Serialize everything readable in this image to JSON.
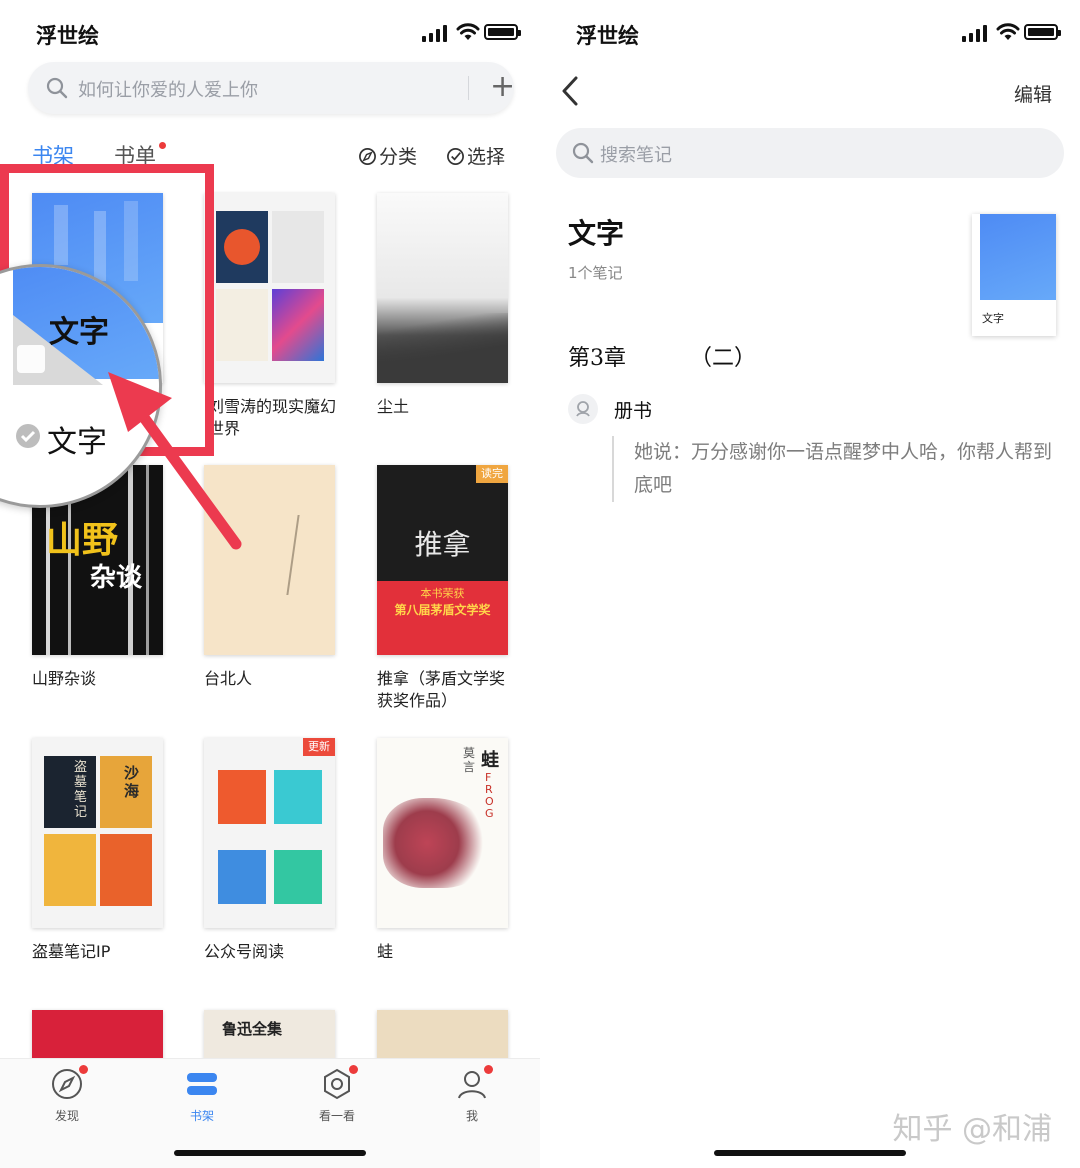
{
  "left": {
    "status": {
      "carrier": "浮世绘"
    },
    "search": {
      "placeholder": "如何让你爱的人爱上你",
      "add_label": "+"
    },
    "tabs": [
      {
        "label": "书架",
        "active": true
      },
      {
        "label": "书单",
        "active": false,
        "dot": true
      }
    ],
    "tools": {
      "classify": "分类",
      "select": "选择"
    },
    "books": [
      {
        "title": "文字",
        "badge": ""
      },
      {
        "title": "刘雪涛的现实魔幻世界",
        "badge": ""
      },
      {
        "title": "尘土",
        "badge": ""
      },
      {
        "title": "山野杂谈",
        "badge": ""
      },
      {
        "title": "台北人",
        "badge": ""
      },
      {
        "title": "推拿（茅盾文学奖获奖作品）",
        "badge": "读完"
      },
      {
        "title": "盗墓笔记IP",
        "badge": ""
      },
      {
        "title": "公众号阅读",
        "badge": "更新"
      },
      {
        "title": "蛙",
        "badge": ""
      }
    ],
    "cover_text": {
      "shanye_big": "山野",
      "shanye_small": "杂谈",
      "tuina": "推拿",
      "tuina_prize_top": "本书荣获",
      "tuina_prize": "第八届茅盾文学奖",
      "luxun": "鲁迅全集",
      "frog": "蛙",
      "frog_author": "莫言",
      "frog_en": "FROG",
      "daomu": "盗墓笔记",
      "shahai": "沙海"
    },
    "magnifier": {
      "cover_label": "文字",
      "title": "文字"
    },
    "nav": [
      {
        "label": "发现",
        "icon": "compass-icon",
        "dot": true,
        "active": false
      },
      {
        "label": "书架",
        "icon": "bookshelf-icon",
        "dot": false,
        "active": true
      },
      {
        "label": "看一看",
        "icon": "look-icon",
        "dot": true,
        "active": false
      },
      {
        "label": "我",
        "icon": "profile-icon",
        "dot": true,
        "active": false
      }
    ],
    "colors": {
      "accent": "#3b86f0",
      "annotation": "#ec3a4f"
    }
  },
  "right": {
    "status": {
      "carrier": "浮世绘"
    },
    "edit_label": "编辑",
    "search_placeholder": "搜索笔记",
    "notebook": {
      "title": "文字",
      "count": "1个笔记",
      "cover_label": "文字"
    },
    "chapter": {
      "name": "第3章",
      "sub": "（二）"
    },
    "note": {
      "author": "册书",
      "text": "她说：万分感谢你一语点醒梦中人哈，你帮人帮到底吧"
    },
    "watermark": "知乎 @和浦"
  }
}
